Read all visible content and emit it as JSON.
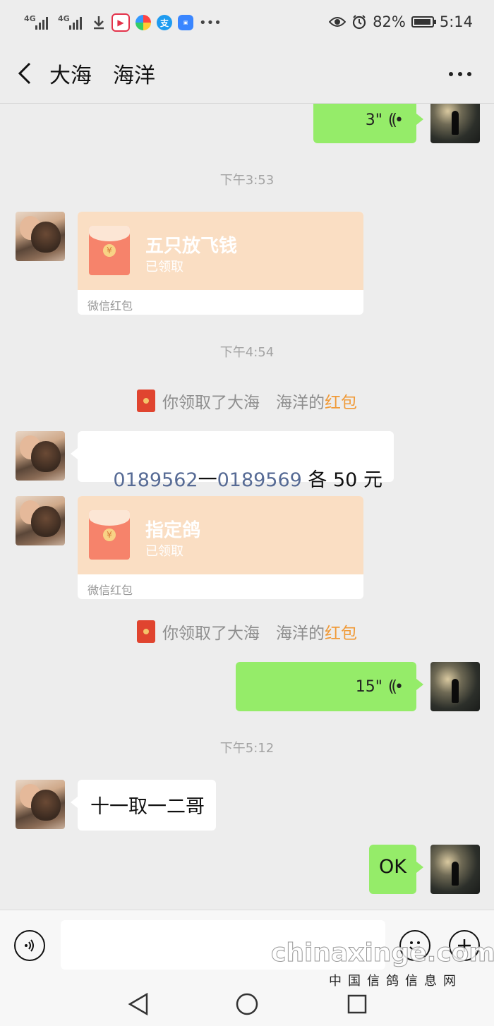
{
  "status_bar": {
    "network_1": "4G",
    "network_2": "4G",
    "battery": "82%",
    "time": "5:14"
  },
  "header": {
    "title": "大海　海洋"
  },
  "messages": {
    "voice_1": {
      "duration": "3\""
    },
    "ts_1": "下午3:53",
    "rp_1": {
      "title": "五只放飞钱",
      "status": "已领取",
      "footer": "微信红包"
    },
    "ts_2": "下午4:54",
    "sys_1": {
      "prefix": "你领取了大海　海洋的",
      "link": "红包"
    },
    "text_1": {
      "part1": "0189562",
      "dash": "一",
      "part2": "0189569",
      "suffix": " 各 50 元"
    },
    "rp_2": {
      "title": "指定鸽",
      "status": "已领取",
      "footer": "微信红包"
    },
    "sys_2": {
      "prefix": "你领取了大海　海洋的",
      "link": "红包"
    },
    "voice_2": {
      "duration": "15\""
    },
    "ts_3": "下午5:12",
    "text_2": "十一取一二哥",
    "text_3": "OK"
  },
  "watermark": {
    "line1": "chinaxinge.com",
    "line2": "中国信鸽信息网"
  },
  "colors": {
    "background": "#ededed",
    "bubble_out": "#95ec69",
    "bubble_in": "#ffffff",
    "red_packet": "#fadec3",
    "link_orange": "#f09a38",
    "number_blue": "#576b95"
  }
}
